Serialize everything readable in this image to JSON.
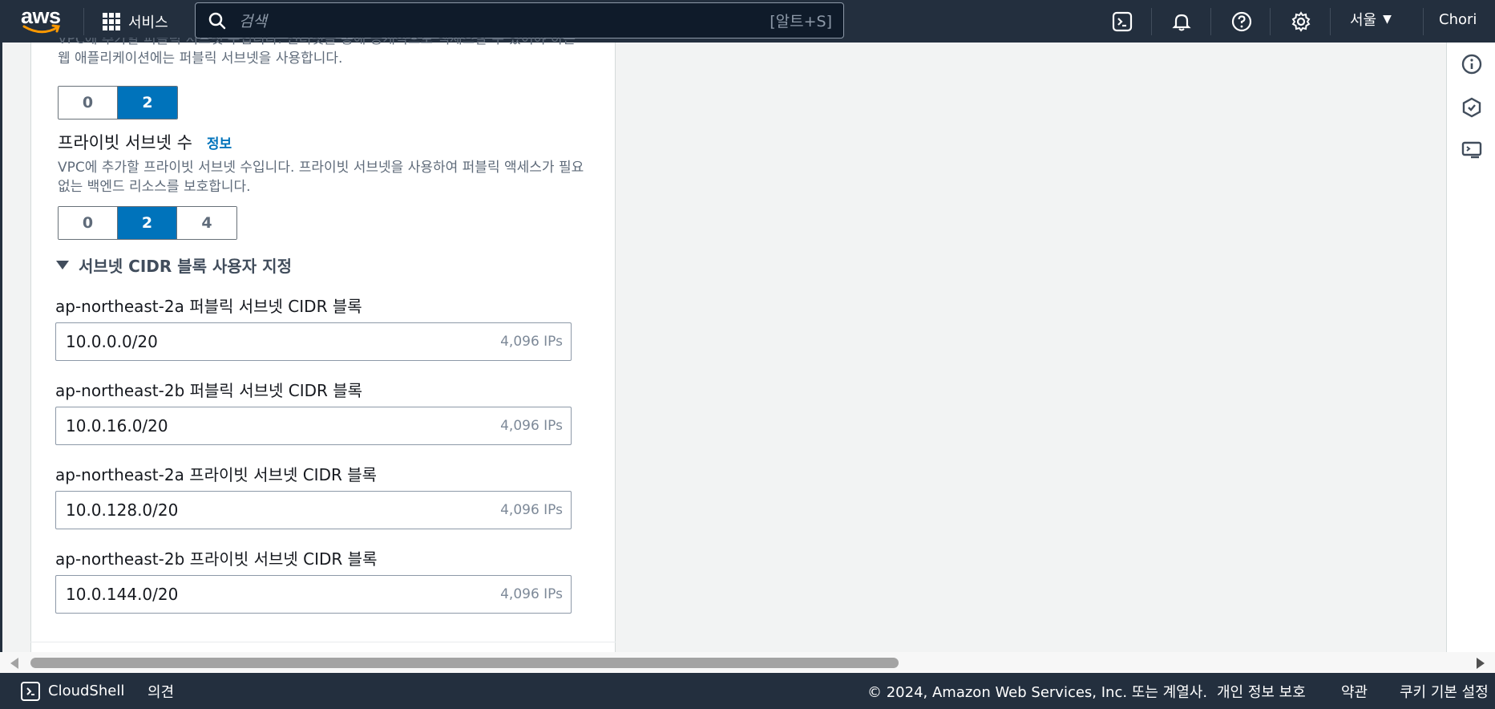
{
  "topnav": {
    "logo_text": "aws",
    "services_label": "서비스",
    "search_placeholder": "검색",
    "search_shortcut": "[알트+S]",
    "region": "서울",
    "user": "Chori"
  },
  "form": {
    "public_subnet_desc": "VPC에 추가할 퍼블릭 서브넷 수입니다. 인터넷을 통해 공개적으로 액세스할 수 있어야 하는 웹 애플리케이션에는 퍼블릭 서브넷을 사용합니다.",
    "public_options": [
      "0",
      "2"
    ],
    "public_selected": "2",
    "private_title": "프라이빗 서브넷 수",
    "info_label": "정보",
    "private_subnet_desc": "VPC에 추가할 프라이빗 서브넷 수입니다. 프라이빗 서브넷을 사용하여 퍼블릭 액세스가 필요 없는 백엔드 리소스를 보호합니다.",
    "private_options": [
      "0",
      "2",
      "4"
    ],
    "private_selected": "2",
    "cidr_section_title": "서브넷 CIDR 블록 사용자 지정",
    "cidr_fields": [
      {
        "label": "ap-northeast-2a 퍼블릭 서브넷 CIDR 블록",
        "value": "10.0.0.0/20",
        "ips": "4,096 IPs"
      },
      {
        "label": "ap-northeast-2b 퍼블릭 서브넷 CIDR 블록",
        "value": "10.0.16.0/20",
        "ips": "4,096 IPs"
      },
      {
        "label": "ap-northeast-2a 프라이빗 서브넷 CIDR 블록",
        "value": "10.0.128.0/20",
        "ips": "4,096 IPs"
      },
      {
        "label": "ap-northeast-2b 프라이빗 서브넷 CIDR 블록",
        "value": "10.0.144.0/20",
        "ips": "4,096 IPs"
      }
    ]
  },
  "footer": {
    "cloudshell": "CloudShell",
    "feedback": "의견",
    "copyright": "© 2024, Amazon Web Services, Inc. 또는 계열사.",
    "privacy": "개인 정보 보호",
    "terms": "약관",
    "cookies": "쿠키 기본 설정"
  },
  "colors": {
    "nav_bg": "#232f3e",
    "selected_blue": "#0073bb",
    "aws_orange": "#ff9900"
  },
  "icons": [
    "grid-icon",
    "search-icon",
    "cloudshell-icon",
    "bell-icon",
    "help-icon",
    "gear-icon",
    "caret-down-icon",
    "info-icon",
    "security-icon",
    "screen-icon"
  ]
}
